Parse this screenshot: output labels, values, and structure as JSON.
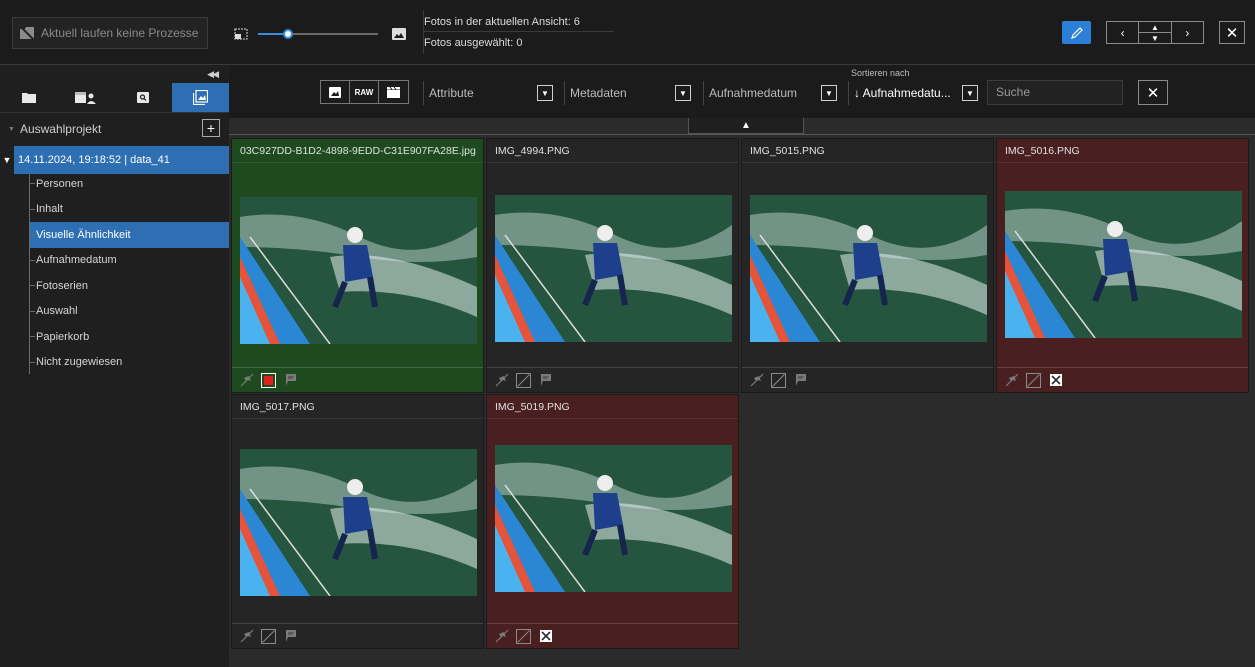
{
  "topbar": {
    "process_status": "Aktuell laufen keine Prozesse",
    "thumb_size_percent": 25,
    "photos_in_view": "Fotos in der aktuellen Ansicht: 6",
    "photos_selected": "Fotos ausgewählt: 0",
    "accent": "#2c7fd6"
  },
  "sidebar": {
    "project": "Auswahlprojekt",
    "add_label": "+",
    "date_node": "14.11.2024, 19:18:52 | data_41",
    "items": [
      {
        "label": "Personen",
        "selected": false
      },
      {
        "label": "Inhalt",
        "selected": false
      },
      {
        "label": "Visuelle Ähnlichkeit",
        "selected": true
      },
      {
        "label": "Aufnahmedatum",
        "selected": false
      },
      {
        "label": "Fotoserien",
        "selected": false
      },
      {
        "label": "Auswahl",
        "selected": false
      },
      {
        "label": "Papierkorb",
        "selected": false
      },
      {
        "label": "Nicht zugewiesen",
        "selected": false
      }
    ]
  },
  "toolbar": {
    "raw_label": "RAW",
    "attribute": "Attribute",
    "metadata": "Metadaten",
    "date": "Aufnahmedatum",
    "sort_caption": "Sortieren nach",
    "sort_value": "↓ Aufnahmedatu...",
    "search_placeholder": "Suche"
  },
  "photos": [
    {
      "name": "03C927DD-B1D2-4898-9EDD-C31E907FA28E.jpg",
      "status": "green",
      "checked": true,
      "flagged": false
    },
    {
      "name": "IMG_4994.PNG",
      "status": "none",
      "checked": false,
      "flagged": false
    },
    {
      "name": "IMG_5015.PNG",
      "status": "none",
      "checked": false,
      "flagged": false
    },
    {
      "name": "IMG_5016.PNG",
      "status": "red",
      "checked": false,
      "flagged": true
    },
    {
      "name": "IMG_5017.PNG",
      "status": "none",
      "checked": false,
      "flagged": false
    },
    {
      "name": "IMG_5019.PNG",
      "status": "red",
      "checked": false,
      "flagged": true
    }
  ],
  "colors": {
    "green_tile": "#1f4a20",
    "red_tile": "#4a1f1f",
    "neutral_tile": "#252525",
    "selection": "#2e6fb3"
  }
}
